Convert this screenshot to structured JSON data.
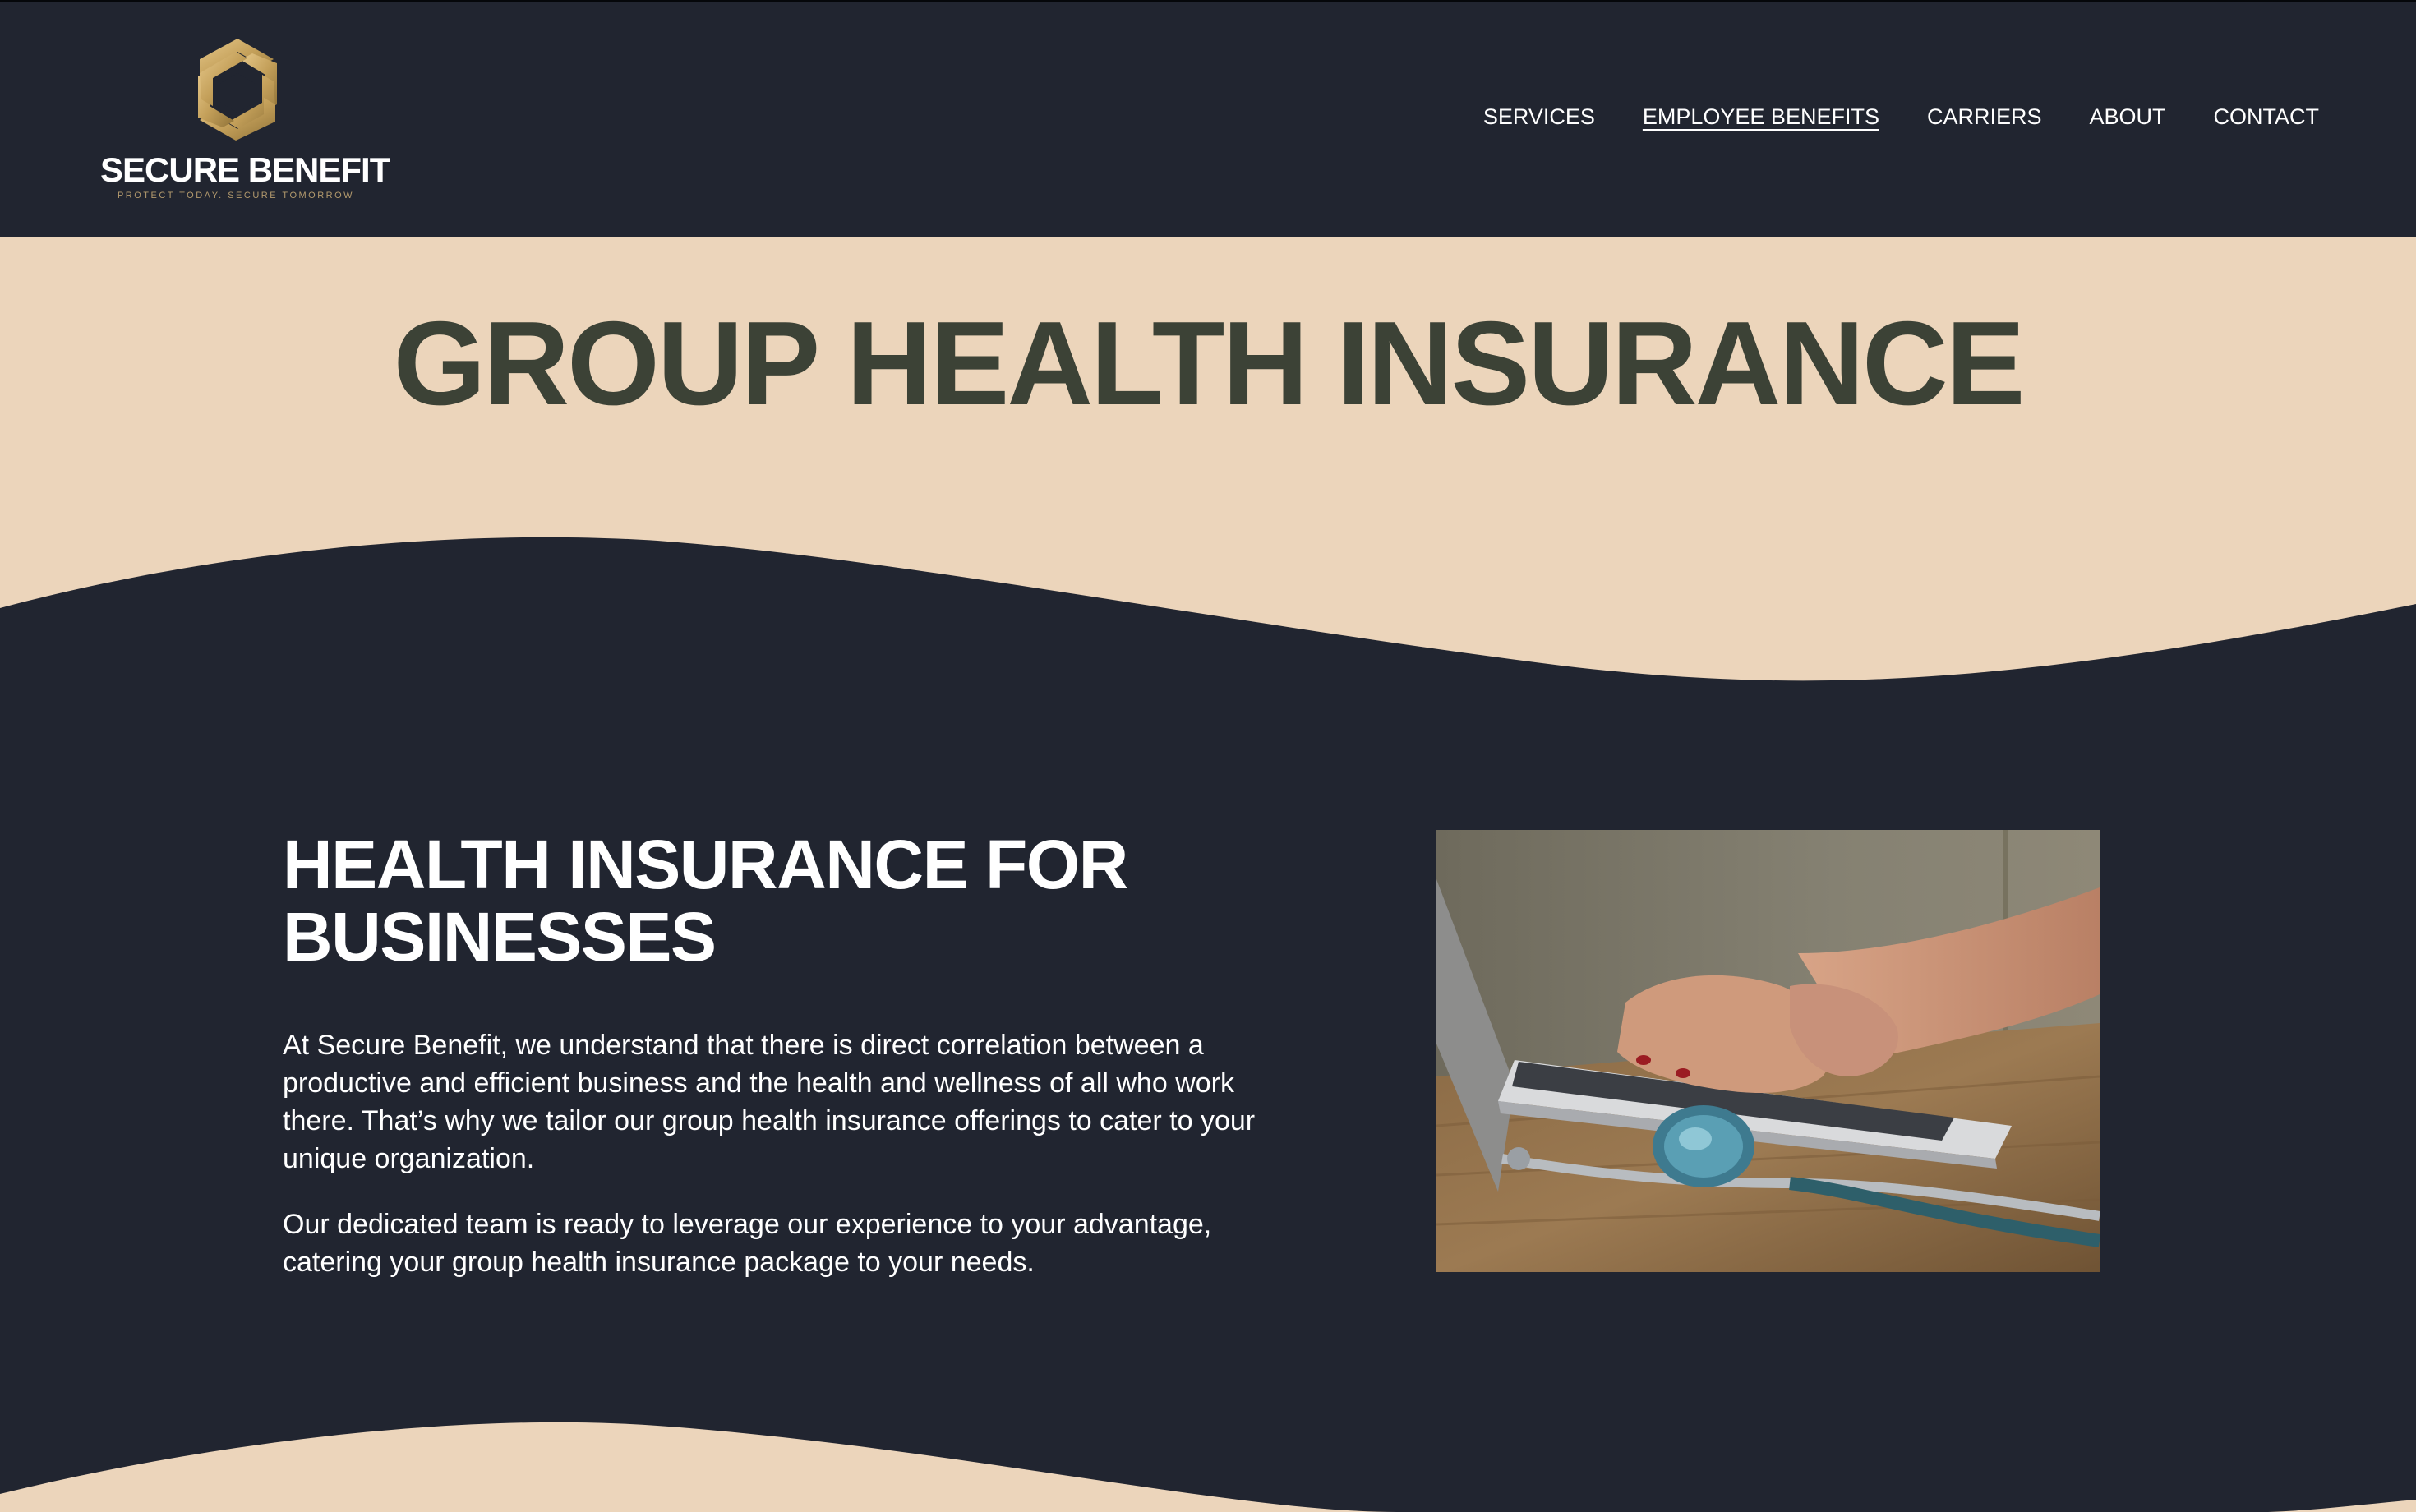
{
  "brand": {
    "name": "SECURE BENEFIT",
    "tagline": "PROTECT TODAY. SECURE TOMORROW"
  },
  "nav": {
    "items": [
      {
        "label": "SERVICES",
        "active": false
      },
      {
        "label": "EMPLOYEE BENEFITS",
        "active": true
      },
      {
        "label": "CARRIERS",
        "active": false
      },
      {
        "label": "ABOUT",
        "active": false
      },
      {
        "label": "CONTACT",
        "active": false
      }
    ]
  },
  "hero": {
    "title": "GROUP HEALTH INSURANCE"
  },
  "main": {
    "heading_line1": "HEALTH INSURANCE FOR",
    "heading_line2": "BUSINESSES",
    "paragraph1": "At Secure Benefit, we understand that there is direct correlation between a productive and efficient business and the health and wellness of all who work there. That’s why we tailor our group health insurance offerings to cater to your unique organization.",
    "paragraph2": "Our dedicated team is ready to leverage our experience to your advantage, catering your group health insurance package to your needs."
  },
  "colors": {
    "header_bg": "#212530",
    "band_beige": "#ecd5bb",
    "hero_title": "#3c4236",
    "logo_gold": "#c9a75e"
  },
  "icons": {
    "logo_mark": "hexagon-swirl-logo-icon"
  }
}
